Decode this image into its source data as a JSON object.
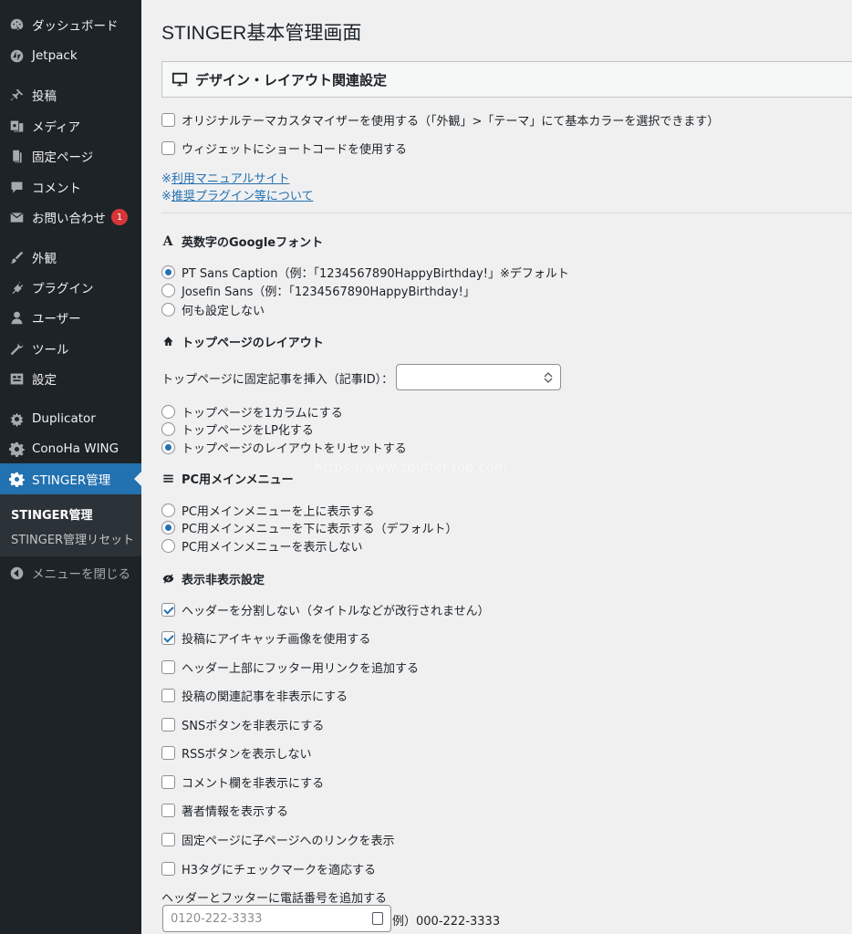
{
  "sidebar": {
    "items": [
      {
        "label": "ダッシュボード",
        "icon": "dashboard-icon"
      },
      {
        "label": "Jetpack",
        "icon": "jetpack-icon"
      },
      {
        "label": "投稿",
        "icon": "pin-icon"
      },
      {
        "label": "メディア",
        "icon": "media-icon"
      },
      {
        "label": "固定ページ",
        "icon": "page-icon"
      },
      {
        "label": "コメント",
        "icon": "comment-icon"
      },
      {
        "label": "お問い合わせ",
        "icon": "mail-icon",
        "badge": "1"
      },
      {
        "label": "外観",
        "icon": "paintbrush-icon"
      },
      {
        "label": "プラグイン",
        "icon": "plugin-icon"
      },
      {
        "label": "ユーザー",
        "icon": "user-icon"
      },
      {
        "label": "ツール",
        "icon": "wrench-icon"
      },
      {
        "label": "設定",
        "icon": "settings-icon"
      },
      {
        "label": "Duplicator",
        "icon": "duplicator-icon"
      },
      {
        "label": "ConoHa WING",
        "icon": "gear-icon"
      },
      {
        "label": "STINGER管理",
        "icon": "gear-icon",
        "current": true
      }
    ],
    "submenu": [
      {
        "label": "STINGER管理",
        "current": true
      },
      {
        "label": "STINGER管理リセット"
      }
    ],
    "collapse_label": "メニューを閉じる"
  },
  "page": {
    "title": "STINGER基本管理画面",
    "section_title": "デザイン・レイアウト関連設定",
    "top_options": [
      {
        "label": "オリジナルテーマカスタマイザーを使用する（「外観」>「テーマ」にて基本カラーを選択できます）",
        "checked": false
      },
      {
        "label": "ウィジェットにショートコードを使用する",
        "checked": false
      }
    ],
    "links": [
      {
        "prefix": "※",
        "label": "利用マニュアルサイト"
      },
      {
        "prefix": "※",
        "label": "推奨プラグイン等について"
      }
    ],
    "font_section": {
      "title": "英数字のGoogleフォント",
      "options": [
        {
          "label": "PT Sans Caption（例：「1234567890HappyBirthday!」※デフォルト",
          "selected": true
        },
        {
          "label": "Josefin Sans（例：「1234567890HappyBirthday!」",
          "selected": false
        },
        {
          "label": "何も設定しない",
          "selected": false
        }
      ]
    },
    "layout_section": {
      "title": "トップページのレイアウト",
      "field_label": "トップページに固定記事を挿入（記事ID）：",
      "field_value": "",
      "options": [
        {
          "label": "トップページを1カラムにする",
          "selected": false
        },
        {
          "label": "トップページをLP化する",
          "selected": false
        },
        {
          "label": "トップページのレイアウトをリセットする",
          "selected": true
        }
      ]
    },
    "menu_section": {
      "title": "PC用メインメニュー",
      "options": [
        {
          "label": "PC用メインメニューを上に表示する",
          "selected": false
        },
        {
          "label": "PC用メインメニューを下に表示する（デフォルト）",
          "selected": true
        },
        {
          "label": "PC用メインメニューを表示しない",
          "selected": false
        }
      ]
    },
    "display_section": {
      "title": "表示非表示設定",
      "options": [
        {
          "label": "ヘッダーを分割しない（タイトルなどが改行されません）",
          "checked": true
        },
        {
          "label": "投稿にアイキャッチ画像を使用する",
          "checked": true
        },
        {
          "label": "ヘッダー上部にフッター用リンクを追加する",
          "checked": false
        },
        {
          "label": "投稿の関連記事を非表示にする",
          "checked": false
        },
        {
          "label": "SNSボタンを非表示にする",
          "checked": false
        },
        {
          "label": "RSSボタンを表示しない",
          "checked": false
        },
        {
          "label": "コメント欄を非表示にする",
          "checked": false
        },
        {
          "label": "著者情報を表示する",
          "checked": false
        },
        {
          "label": "固定ページに子ページへのリンクを表示",
          "checked": false
        },
        {
          "label": "H3タグにチェックマークを適応する",
          "checked": false
        }
      ]
    },
    "phone": {
      "label": "ヘッダーとフッターに電話番号を追加する",
      "placeholder": "0120-222-3333",
      "example": "例）000-222-3333"
    },
    "watermark": "https://www.zbuffer.top.com"
  },
  "colors": {
    "sidebar_bg": "#1d2327",
    "accent": "#2271b1",
    "badge": "#d63638"
  }
}
